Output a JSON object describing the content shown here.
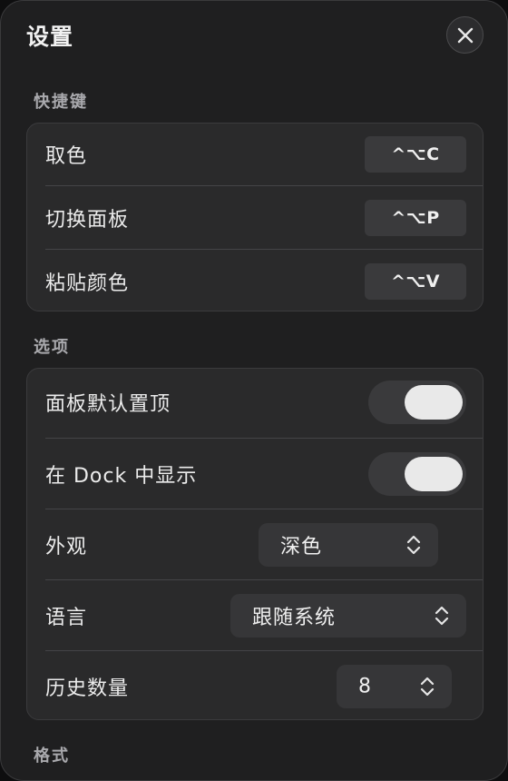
{
  "window": {
    "title": "设置"
  },
  "sections": {
    "shortcuts": {
      "label": "快捷键",
      "items": [
        {
          "label": "取色",
          "keys": "^⌥C"
        },
        {
          "label": "切换面板",
          "keys": "^⌥P"
        },
        {
          "label": "粘贴颜色",
          "keys": "^⌥V"
        }
      ]
    },
    "options": {
      "label": "选项",
      "pin_panel": {
        "label": "面板默认置顶",
        "on": true
      },
      "show_in_dock": {
        "label": "在 Dock 中显示",
        "on": true
      },
      "appearance": {
        "label": "外观",
        "value": "深色"
      },
      "language": {
        "label": "语言",
        "value": "跟随系统"
      },
      "history": {
        "label": "历史数量",
        "value": "8"
      }
    },
    "format": {
      "label": "格式"
    }
  },
  "icons": {
    "close": "close-icon",
    "chevron": "chevron-up-down-icon"
  },
  "colors": {
    "window_bg": "#1f1f20",
    "card_bg": "#2a2a2b",
    "control_bg": "#3a3a3c",
    "knob": "#e9e9e9",
    "text": "#ececec",
    "section_text": "#a9a9ad"
  }
}
